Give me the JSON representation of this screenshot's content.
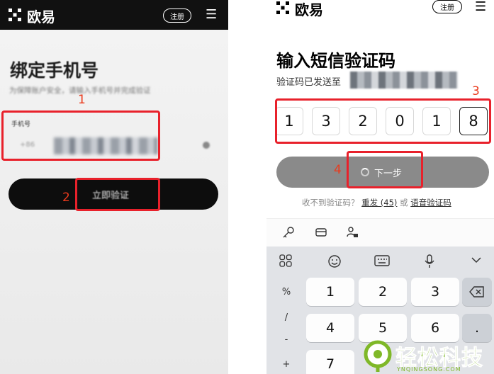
{
  "left_screen": {
    "brand": "欧易",
    "register": "注册",
    "title": "绑定手机号",
    "subtitle": "为保障账户安全，请输入手机号并完成验证",
    "phone_label": "手机号",
    "country_code": "+86",
    "verify_button": "立即验证",
    "menu_icon": "hamburger-icon"
  },
  "right_screen": {
    "brand": "欧易",
    "register": "注册",
    "title": "输入短信验证码",
    "sent_to": "验证码已发送至",
    "code_digits": [
      "1",
      "3",
      "2",
      "0",
      "1",
      "8"
    ],
    "next_button": "下一步",
    "not_received": "收不到验证码？",
    "resend": "重发 (45)",
    "or": "或",
    "voice_code": "语音验证码",
    "keyboard": {
      "rows": [
        {
          "left": "%",
          "keys": [
            "1",
            "2",
            "3"
          ]
        },
        {
          "left": "/",
          "keys": [
            "4",
            "5",
            "6"
          ],
          "right": "."
        },
        {
          "left": "-",
          "keys": [
            "7"
          ]
        },
        {
          "left": "+"
        }
      ]
    }
  },
  "annotations": [
    "1",
    "2",
    "3",
    "4"
  ],
  "watermark": {
    "text": "轻松科技",
    "url_text": "YNQINGSONG.COM"
  },
  "colors": {
    "highlight": "#e8212b",
    "annotation_number": "#ea3a1c",
    "watermark_green": "#7fb828"
  }
}
